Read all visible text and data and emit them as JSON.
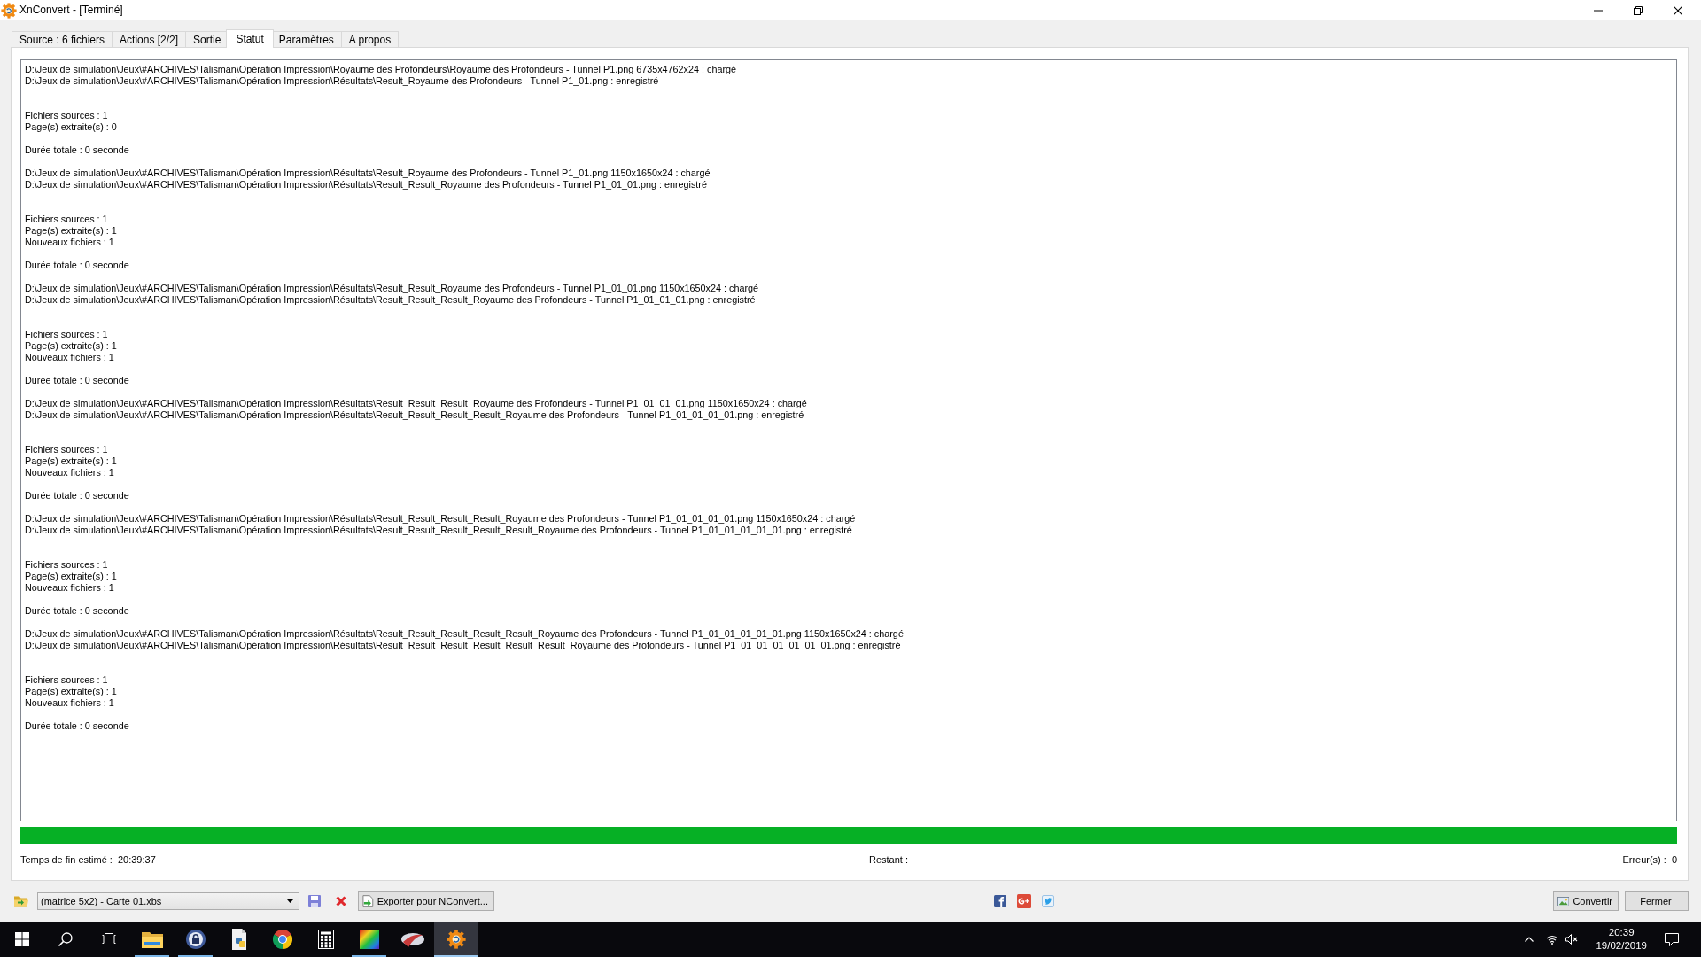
{
  "window": {
    "title": "XnConvert - [Terminé]"
  },
  "tabs": [
    {
      "label": "Source : 6 fichiers",
      "selected": false
    },
    {
      "label": "Actions [2/2]",
      "selected": false
    },
    {
      "label": "Sortie",
      "selected": false
    },
    {
      "label": "Statut",
      "selected": true
    },
    {
      "label": "Paramètres",
      "selected": false
    },
    {
      "label": "A propos",
      "selected": false
    }
  ],
  "log": [
    {
      "loaded": "D:\\Jeux de simulation\\Jeux\\#ARCHIVES\\Talisman\\Opération Impression\\Royaume des Profondeurs\\Royaume des Profondeurs - Tunnel P1.png 6735x4762x24 : chargé",
      "saved": "D:\\Jeux de simulation\\Jeux\\#ARCHIVES\\Talisman\\Opération Impression\\Résultats\\Result_Royaume des Profondeurs - Tunnel P1_01.png : enregistré",
      "stats": [
        "Fichiers sources : 1",
        "Page(s) extraite(s) : 0"
      ],
      "duration": "Durée totale : 0 seconde"
    },
    {
      "loaded": "D:\\Jeux de simulation\\Jeux\\#ARCHIVES\\Talisman\\Opération Impression\\Résultats\\Result_Royaume des Profondeurs - Tunnel P1_01.png 1150x1650x24 : chargé",
      "saved": "D:\\Jeux de simulation\\Jeux\\#ARCHIVES\\Talisman\\Opération Impression\\Résultats\\Result_Result_Royaume des Profondeurs - Tunnel P1_01_01.png : enregistré",
      "stats": [
        "Fichiers sources : 1",
        "Page(s) extraite(s) : 1",
        "Nouveaux fichiers : 1"
      ],
      "duration": "Durée totale : 0 seconde"
    },
    {
      "loaded": "D:\\Jeux de simulation\\Jeux\\#ARCHIVES\\Talisman\\Opération Impression\\Résultats\\Result_Result_Royaume des Profondeurs - Tunnel P1_01_01.png 1150x1650x24 : chargé",
      "saved": "D:\\Jeux de simulation\\Jeux\\#ARCHIVES\\Talisman\\Opération Impression\\Résultats\\Result_Result_Result_Royaume des Profondeurs - Tunnel P1_01_01_01.png : enregistré",
      "stats": [
        "Fichiers sources : 1",
        "Page(s) extraite(s) : 1",
        "Nouveaux fichiers : 1"
      ],
      "duration": "Durée totale : 0 seconde"
    },
    {
      "loaded": "D:\\Jeux de simulation\\Jeux\\#ARCHIVES\\Talisman\\Opération Impression\\Résultats\\Result_Result_Result_Royaume des Profondeurs - Tunnel P1_01_01_01.png 1150x1650x24 : chargé",
      "saved": "D:\\Jeux de simulation\\Jeux\\#ARCHIVES\\Talisman\\Opération Impression\\Résultats\\Result_Result_Result_Result_Royaume des Profondeurs - Tunnel P1_01_01_01_01.png : enregistré",
      "stats": [
        "Fichiers sources : 1",
        "Page(s) extraite(s) : 1",
        "Nouveaux fichiers : 1"
      ],
      "duration": "Durée totale : 0 seconde"
    },
    {
      "loaded": "D:\\Jeux de simulation\\Jeux\\#ARCHIVES\\Talisman\\Opération Impression\\Résultats\\Result_Result_Result_Result_Royaume des Profondeurs - Tunnel P1_01_01_01_01.png 1150x1650x24 : chargé",
      "saved": "D:\\Jeux de simulation\\Jeux\\#ARCHIVES\\Talisman\\Opération Impression\\Résultats\\Result_Result_Result_Result_Result_Royaume des Profondeurs - Tunnel P1_01_01_01_01_01.png : enregistré",
      "stats": [
        "Fichiers sources : 1",
        "Page(s) extraite(s) : 1",
        "Nouveaux fichiers : 1"
      ],
      "duration": "Durée totale : 0 seconde"
    },
    {
      "loaded": "D:\\Jeux de simulation\\Jeux\\#ARCHIVES\\Talisman\\Opération Impression\\Résultats\\Result_Result_Result_Result_Result_Royaume des Profondeurs - Tunnel P1_01_01_01_01_01.png 1150x1650x24 : chargé",
      "saved": "D:\\Jeux de simulation\\Jeux\\#ARCHIVES\\Talisman\\Opération Impression\\Résultats\\Result_Result_Result_Result_Result_Result_Royaume des Profondeurs - Tunnel P1_01_01_01_01_01_01.png : enregistré",
      "stats": [
        "Fichiers sources : 1",
        "Page(s) extraite(s) : 1",
        "Nouveaux fichiers : 1"
      ],
      "duration": "Durée totale : 0 seconde"
    }
  ],
  "progress": {
    "level": 1
  },
  "status": {
    "estimated_end_label": "Temps de fin estimé :",
    "estimated_end": "20:39:37",
    "remaining_label": "Restant :",
    "errors_label": "Erreur(s) :",
    "errors": "0"
  },
  "toolbar": {
    "preset": "(matrice 5x2) - Carte 01.xbs",
    "export_button": "Exporter pour NConvert...",
    "convert_button": "Convertir",
    "close_button": "Fermer"
  },
  "taskbar": {
    "apps": [
      {
        "kind": "folder",
        "running": true,
        "selected": false
      },
      {
        "kind": "lock",
        "running": true,
        "selected": false
      },
      {
        "kind": "document",
        "running": false,
        "selected": false
      },
      {
        "kind": "browser",
        "running": false,
        "selected": false
      },
      {
        "kind": "calculator",
        "running": false,
        "selected": false
      },
      {
        "kind": "gradient",
        "running": true,
        "selected": false
      },
      {
        "kind": "swoosh",
        "running": false,
        "selected": false
      },
      {
        "kind": "gear",
        "running": true,
        "selected": true
      }
    ],
    "time": "20:39",
    "date": "19/02/2019"
  }
}
